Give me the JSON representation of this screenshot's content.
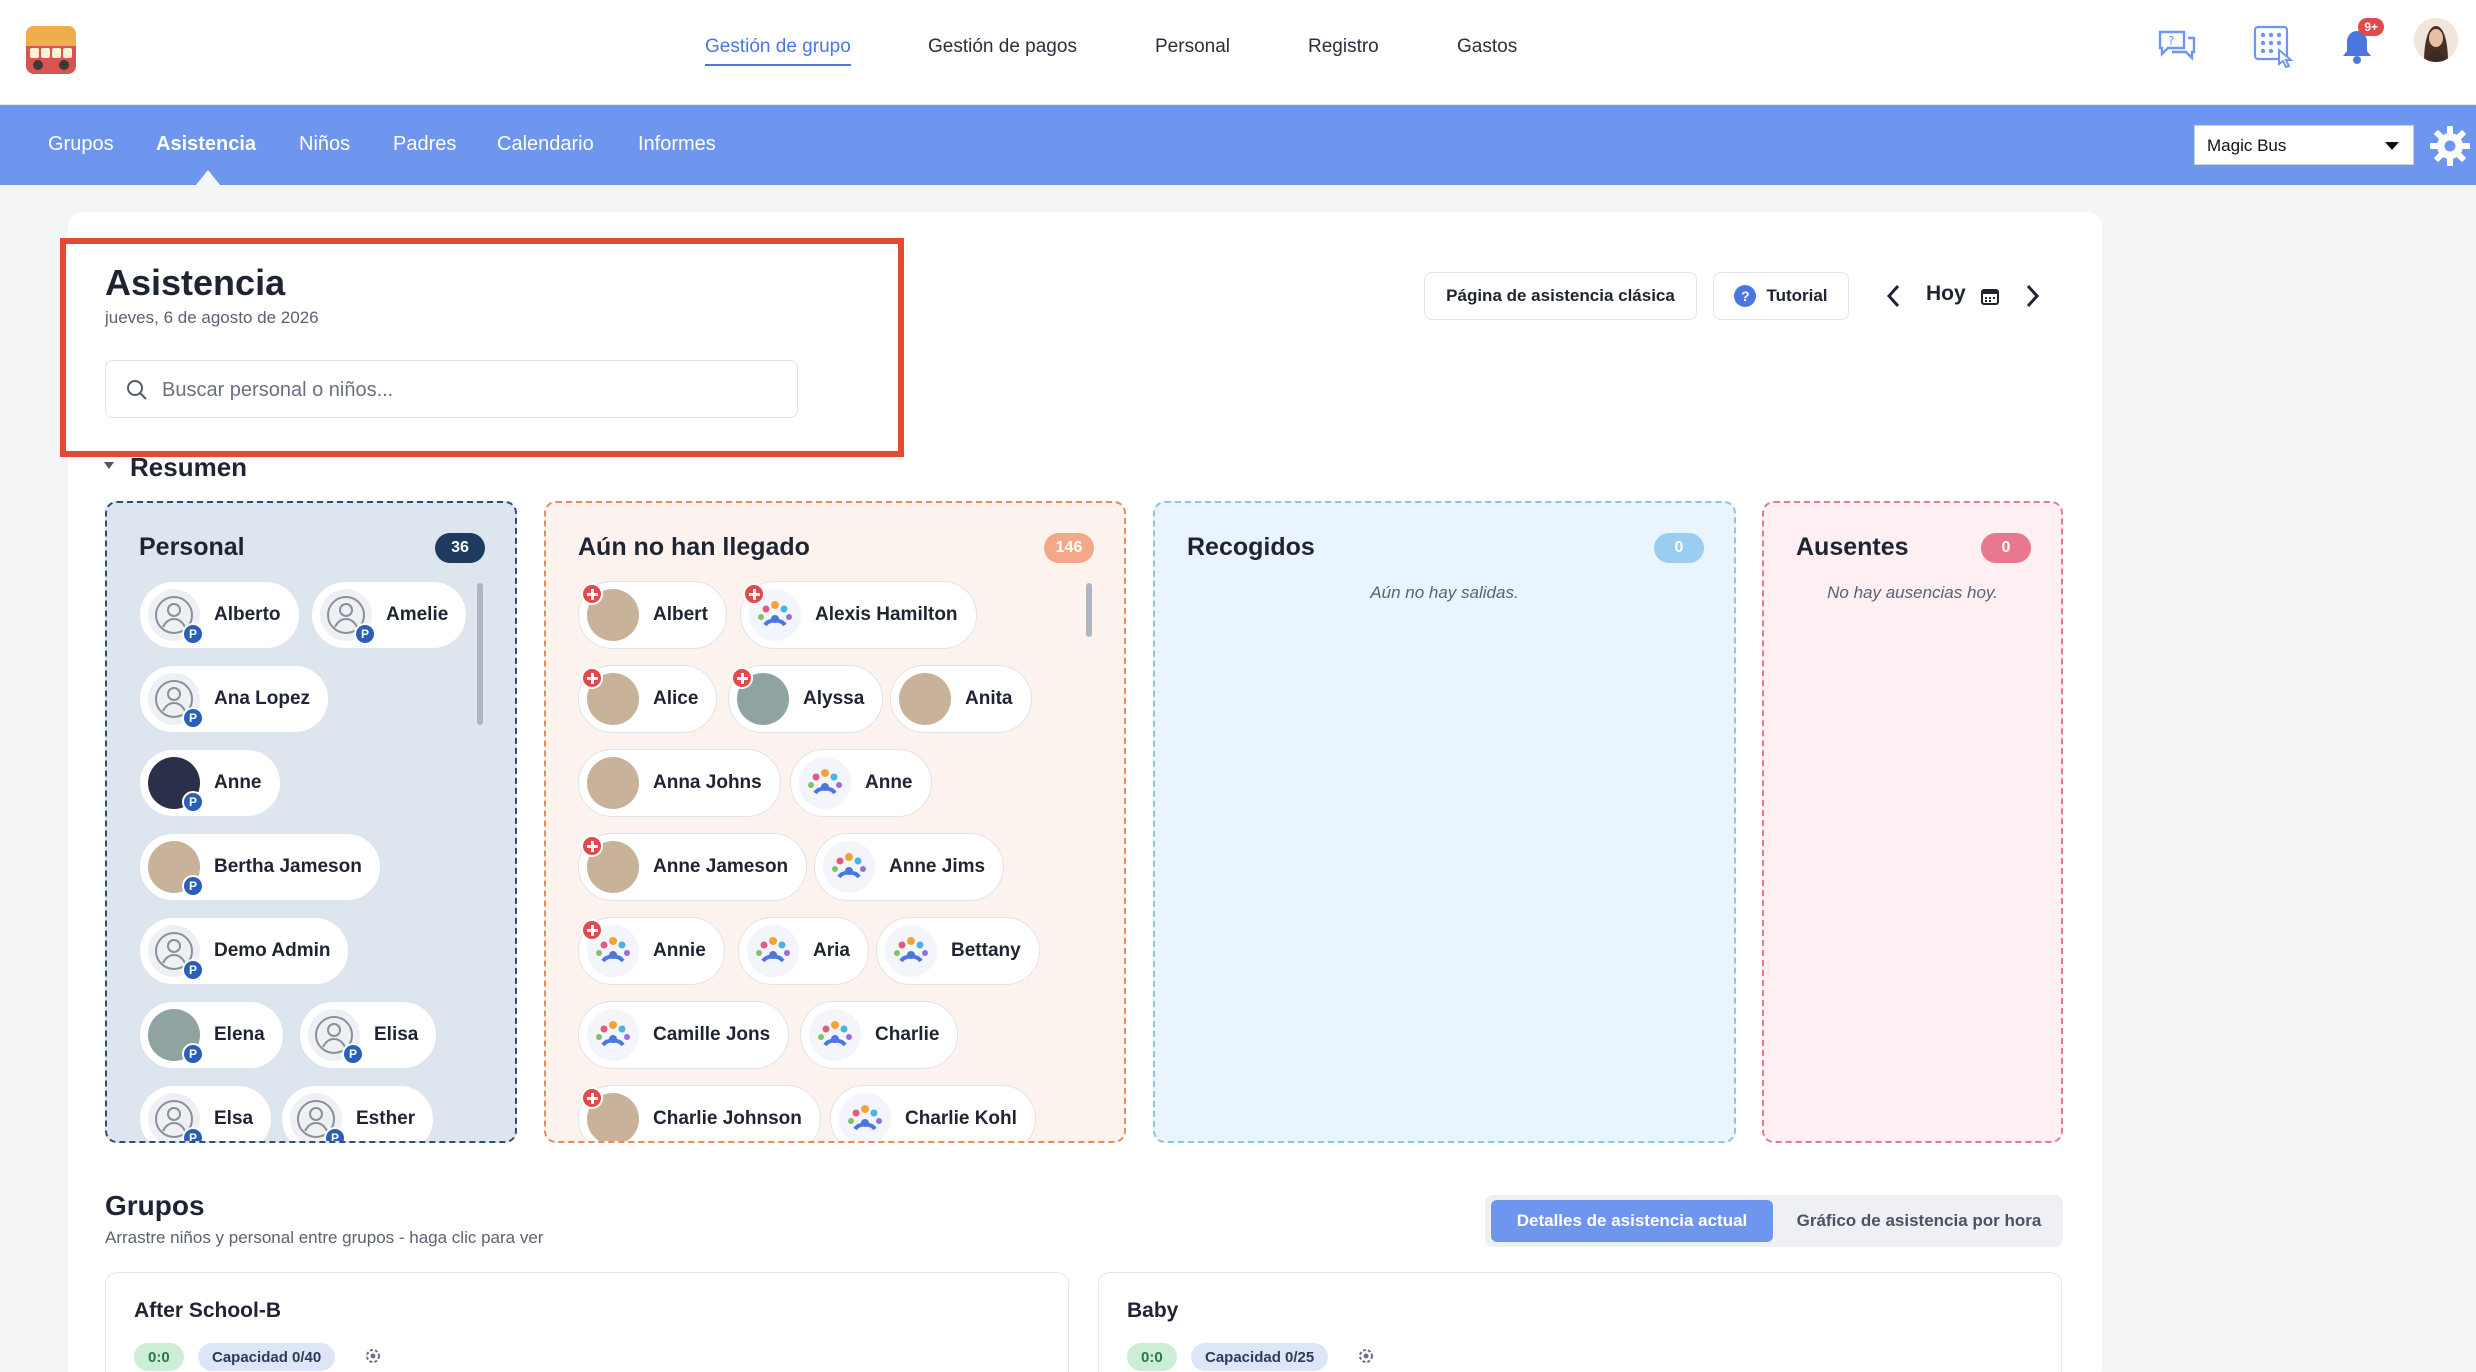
{
  "topnav": {
    "items": [
      "Gestión de grupo",
      "Gestión de pagos",
      "Personal",
      "Registro",
      "Gastos"
    ],
    "active": "Gestión de grupo",
    "notifications_badge": "9+"
  },
  "subnav": {
    "items": [
      "Grupos",
      "Asistencia",
      "Niños",
      "Padres",
      "Calendario",
      "Informes"
    ],
    "active": "Asistencia",
    "school_selected": "Magic Bus"
  },
  "header": {
    "title": "Asistencia",
    "date": "jueves, 6 de agosto de 2026",
    "search_placeholder": "Buscar personal o niños...",
    "classic_button": "Página de asistencia clásica",
    "tutorial_button": "Tutorial",
    "today_label": "Hoy"
  },
  "resumen": {
    "label": "Resumen",
    "personal": {
      "title": "Personal",
      "count": "36",
      "people": [
        "Alberto",
        "Amelie",
        "Ana Lopez",
        "Anne",
        "Bertha Jameson",
        "Demo Admin",
        "Elena",
        "Elisa",
        "Elsa",
        "Esther"
      ]
    },
    "pending": {
      "title": "Aún no han llegado",
      "count": "146",
      "children": [
        "Albert",
        "Alexis Hamilton",
        "Alice",
        "Alyssa",
        "Anita",
        "Anna Johns",
        "Anne",
        "Anne Jameson",
        "Anne Jims",
        "Annie",
        "Aria",
        "Bettany",
        "Camille Jons",
        "Charlie",
        "Charlie Johnson",
        "Charlie Kohl"
      ]
    },
    "picked": {
      "title": "Recogidos",
      "count": "0",
      "empty": "Aún no hay salidas."
    },
    "absent": {
      "title": "Ausentes",
      "count": "0",
      "empty": "No hay ausencias hoy."
    }
  },
  "groups": {
    "title": "Grupos",
    "subtitle": "Arrastre niños y personal entre grupos - haga clic para ver",
    "toggle": [
      "Detalles de asistencia actual",
      "Gráfico de asistencia por hora"
    ],
    "cards": [
      {
        "name": "After School-B",
        "ratio": "0:0",
        "capacity": "Capacidad 0/40"
      },
      {
        "name": "Baby",
        "ratio": "0:0",
        "capacity": "Capacidad 0/25"
      }
    ]
  },
  "colors": {
    "accent": "#6e96ee",
    "highlight": "#e24a33",
    "staff_panel": "#dde6ef",
    "pending_panel": "#fdf3ee",
    "picked_panel": "#eaf4fc",
    "absent_panel": "#fdeff2"
  }
}
